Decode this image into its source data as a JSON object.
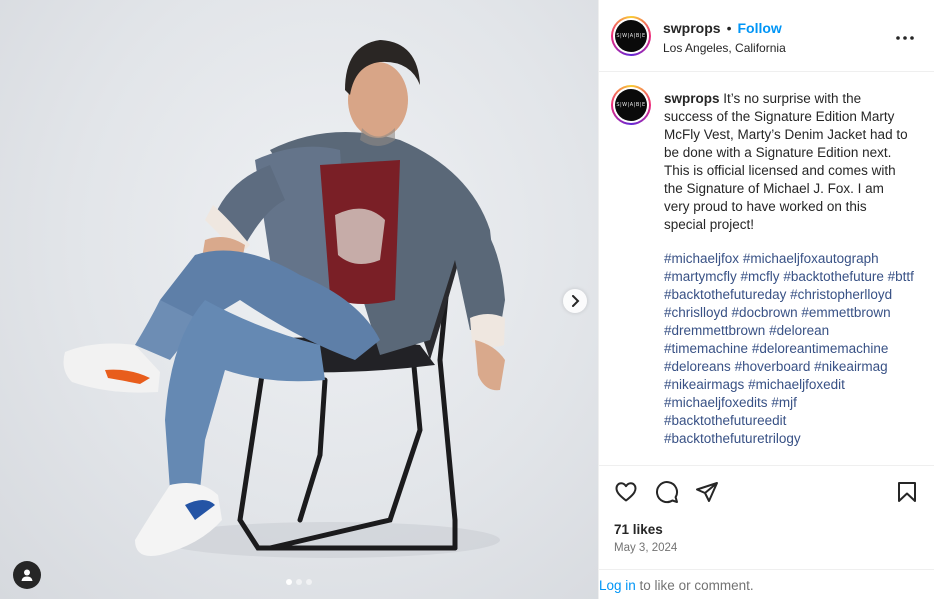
{
  "post": {
    "username": "swprops",
    "bullet": "•",
    "follow_label": "Follow",
    "location": "Los Angeles, California",
    "avatar_text": "S|W|A|B|E"
  },
  "caption": {
    "username": "swprops",
    "text": " It’s no surprise with the success of the Signature Edition Marty McFly Vest, Marty’s Denim Jacket had to be done with a Signature Edition next. This is official licensed and comes with the Signature of Michael J. Fox. I am very proud to have worked on this special project!",
    "hashtags": [
      "#michaeljfox",
      "#michaeljfoxautograph",
      "#martymcfly",
      "#mcfly",
      "#backtothefuture",
      "#bttf",
      "#backtothefutureday",
      "#christopherlloyd",
      "#chrislloyd",
      "#docbrown",
      "#emmettbrown",
      "#dremmettbrown",
      "#delorean",
      "#timemachine",
      "#deloreantimemachine",
      "#deloreans",
      "#hoverboard",
      "#nikeairmag",
      "#nikeairmags",
      "#michaeljfoxedit",
      "#michaeljfoxedits",
      "#mjf",
      "#backtothefutureedit",
      "#backtothefuturetrilogy"
    ]
  },
  "engagement": {
    "likes": "71 likes",
    "date": "May 3, 2024"
  },
  "footer": {
    "login_label": "Log in",
    "login_suffix": " to like or comment."
  },
  "carousel": {
    "slide_count": 3,
    "active_slide": 1
  },
  "icons": {
    "more": "more-options-icon",
    "like": "heart-icon",
    "comment": "comment-icon",
    "share": "share-icon",
    "save": "bookmark-icon",
    "next": "chevron-right-icon",
    "user_tag": "user-tag-icon"
  },
  "colors": {
    "accent": "#0095f6",
    "hashtag": "#385185",
    "text": "#262626",
    "muted": "#737373"
  }
}
